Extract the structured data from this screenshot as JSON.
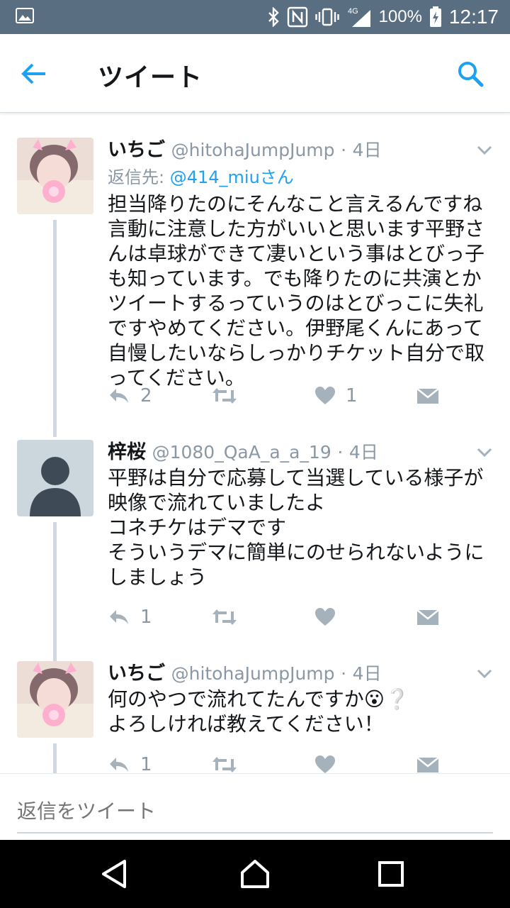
{
  "status_bar": {
    "battery": "100%",
    "network": "4G",
    "time": "12:17",
    "icons": [
      "image-icon",
      "bluetooth-icon",
      "nfc-icon",
      "vibrate-icon",
      "signal-icon",
      "battery-icon"
    ]
  },
  "app_bar": {
    "title": "ツイート",
    "back_icon": "arrow-left-icon",
    "search_icon": "search-icon",
    "accent": "#1da1f2"
  },
  "tweets": [
    {
      "name": "いちご",
      "handle": "@hitohaJumpJump",
      "dot": "·",
      "time": "4日",
      "reply_label": "返信先:",
      "reply_to": "@414_miuさん",
      "text": "担当降りたのにそんなこと言えるんですね言動に注意した方がいいと思います平野さんは卓球ができて凄いという事はとびっ子も知っています。でも降りたのに共演とかツイートするっていうのはとびっこに失礼ですやめてください。伊野尾くんにあって自慢したいならしっかりチケット自分で取ってください。",
      "replies": "2",
      "retweets": "",
      "likes": "1"
    },
    {
      "name": "梓桜",
      "handle": "@1080_QaA_a_a_19",
      "dot": "·",
      "time": "4日",
      "text": "平野は自分で応募して当選している様子が映像で流れていましたよ\nコネチケはデマです\nそういうデマに簡単にのせられないようにしましょう",
      "replies": "1",
      "retweets": "",
      "likes": ""
    },
    {
      "name": "いちご",
      "handle": "@hitohaJumpJump",
      "dot": "·",
      "time": "4日",
      "text": "何のやつで流れてたんですか😮❔\nよろしければ教えてください！",
      "replies": "1",
      "retweets": "",
      "likes": ""
    }
  ],
  "reply_bar": {
    "placeholder": "返信をツイート"
  },
  "nav_bar": {
    "icons": [
      "back-triangle-icon",
      "home-icon",
      "recents-icon"
    ]
  }
}
